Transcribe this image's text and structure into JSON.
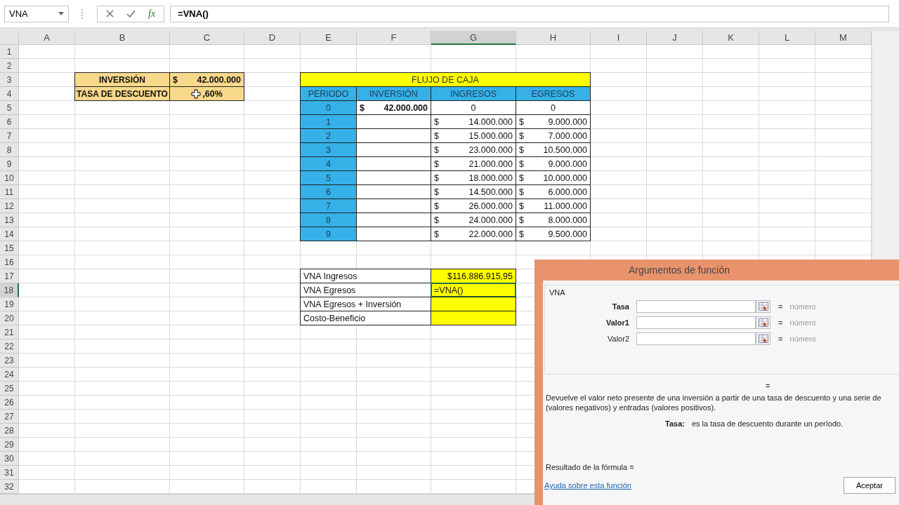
{
  "formula_bar": {
    "name_box": "VNA",
    "function_button": "fx",
    "formula": "=VNA()"
  },
  "sheet": {
    "columns": [
      {
        "label": "A",
        "selected": false
      },
      {
        "label": "B",
        "selected": false
      },
      {
        "label": "C",
        "selected": false
      },
      {
        "label": "D",
        "selected": false
      },
      {
        "label": "E",
        "selected": false
      },
      {
        "label": "F",
        "selected": false
      },
      {
        "label": "G",
        "selected": true
      },
      {
        "label": "H",
        "selected": false
      },
      {
        "label": "I",
        "selected": false
      },
      {
        "label": "J",
        "selected": false
      },
      {
        "label": "K",
        "selected": false
      },
      {
        "label": "L",
        "selected": false
      },
      {
        "label": "M",
        "selected": false
      }
    ],
    "rows": [
      {
        "label": "1",
        "selected": false
      },
      {
        "label": "2",
        "selected": false
      },
      {
        "label": "3",
        "selected": false,
        "cells": [
          {
            "kind": "blank"
          },
          {
            "kind": "tan-label",
            "text": "INVERSIÓN"
          },
          {
            "kind": "tan-currency",
            "symbol": "$",
            "amount": "42.000.000"
          },
          {
            "kind": "blank"
          },
          {
            "kind": "title",
            "text": "FLUJO DE CAJA"
          }
        ]
      },
      {
        "label": "4",
        "selected": false,
        "cells": [
          {
            "kind": "blank"
          },
          {
            "kind": "tan-label",
            "text": "TASA DE DESCUENTO"
          },
          {
            "kind": "tan-percent",
            "text": ",60%"
          },
          {
            "kind": "blank"
          },
          {
            "kind": "blue",
            "text": "PERIODO"
          },
          {
            "kind": "blue",
            "text": "INVERSIÓN"
          },
          {
            "kind": "blue",
            "text": "INGRESOS"
          },
          {
            "kind": "blue",
            "text": "EGRESOS"
          }
        ]
      },
      {
        "label": "5",
        "selected": false,
        "cells": [
          {
            "kind": "blank"
          },
          {
            "kind": "blank"
          },
          {
            "kind": "blank"
          },
          {
            "kind": "blank"
          },
          {
            "kind": "blue",
            "text": "0"
          },
          {
            "kind": "currency-bold",
            "symbol": "$",
            "amount": "42.000.000"
          },
          {
            "kind": "number",
            "text": "0"
          },
          {
            "kind": "number",
            "text": "0"
          }
        ]
      },
      {
        "label": "6",
        "selected": false,
        "cells": [
          {
            "kind": "blank"
          },
          {
            "kind": "blank"
          },
          {
            "kind": "blank"
          },
          {
            "kind": "blank"
          },
          {
            "kind": "blue",
            "text": "1"
          },
          {
            "kind": "empty"
          },
          {
            "kind": "currency",
            "symbol": "$",
            "amount": "14.000.000"
          },
          {
            "kind": "currency",
            "symbol": "$",
            "amount": "9.000.000"
          }
        ]
      },
      {
        "label": "7",
        "selected": false,
        "cells": [
          {
            "kind": "blank"
          },
          {
            "kind": "blank"
          },
          {
            "kind": "blank"
          },
          {
            "kind": "blank"
          },
          {
            "kind": "blue",
            "text": "2"
          },
          {
            "kind": "empty"
          },
          {
            "kind": "currency",
            "symbol": "$",
            "amount": "15.000.000"
          },
          {
            "kind": "currency",
            "symbol": "$",
            "amount": "7.000.000"
          }
        ]
      },
      {
        "label": "8",
        "selected": false,
        "cells": [
          {
            "kind": "blank"
          },
          {
            "kind": "blank"
          },
          {
            "kind": "blank"
          },
          {
            "kind": "blank"
          },
          {
            "kind": "blue",
            "text": "3"
          },
          {
            "kind": "empty"
          },
          {
            "kind": "currency",
            "symbol": "$",
            "amount": "23.000.000"
          },
          {
            "kind": "currency",
            "symbol": "$",
            "amount": "10.500.000"
          }
        ]
      },
      {
        "label": "9",
        "selected": false,
        "cells": [
          {
            "kind": "blank"
          },
          {
            "kind": "blank"
          },
          {
            "kind": "blank"
          },
          {
            "kind": "blank"
          },
          {
            "kind": "blue",
            "text": "4"
          },
          {
            "kind": "empty"
          },
          {
            "kind": "currency",
            "symbol": "$",
            "amount": "21.000.000"
          },
          {
            "kind": "currency",
            "symbol": "$",
            "amount": "9.000.000"
          }
        ]
      },
      {
        "label": "10",
        "selected": false,
        "cells": [
          {
            "kind": "blank"
          },
          {
            "kind": "blank"
          },
          {
            "kind": "blank"
          },
          {
            "kind": "blank"
          },
          {
            "kind": "blue",
            "text": "5"
          },
          {
            "kind": "empty"
          },
          {
            "kind": "currency",
            "symbol": "$",
            "amount": "18.000.000"
          },
          {
            "kind": "currency",
            "symbol": "$",
            "amount": "10.000.000"
          }
        ]
      },
      {
        "label": "11",
        "selected": false,
        "cells": [
          {
            "kind": "blank"
          },
          {
            "kind": "blank"
          },
          {
            "kind": "blank"
          },
          {
            "kind": "blank"
          },
          {
            "kind": "blue",
            "text": "6"
          },
          {
            "kind": "empty"
          },
          {
            "kind": "currency",
            "symbol": "$",
            "amount": "14.500.000"
          },
          {
            "kind": "currency",
            "symbol": "$",
            "amount": "6.000.000"
          }
        ]
      },
      {
        "label": "12",
        "selected": false,
        "cells": [
          {
            "kind": "blank"
          },
          {
            "kind": "blank"
          },
          {
            "kind": "blank"
          },
          {
            "kind": "blank"
          },
          {
            "kind": "blue",
            "text": "7"
          },
          {
            "kind": "empty"
          },
          {
            "kind": "currency",
            "symbol": "$",
            "amount": "26.000.000"
          },
          {
            "kind": "currency",
            "symbol": "$",
            "amount": "11.000.000"
          }
        ]
      },
      {
        "label": "13",
        "selected": false,
        "cells": [
          {
            "kind": "blank"
          },
          {
            "kind": "blank"
          },
          {
            "kind": "blank"
          },
          {
            "kind": "blank"
          },
          {
            "kind": "blue",
            "text": "8"
          },
          {
            "kind": "empty"
          },
          {
            "kind": "currency",
            "symbol": "$",
            "amount": "24.000.000"
          },
          {
            "kind": "currency",
            "symbol": "$",
            "amount": "8.000.000"
          }
        ]
      },
      {
        "label": "14",
        "selected": false,
        "cells": [
          {
            "kind": "blank"
          },
          {
            "kind": "blank"
          },
          {
            "kind": "blank"
          },
          {
            "kind": "blank"
          },
          {
            "kind": "blue",
            "text": "9"
          },
          {
            "kind": "empty"
          },
          {
            "kind": "currency",
            "symbol": "$",
            "amount": "22.000.000"
          },
          {
            "kind": "currency",
            "symbol": "$",
            "amount": "9.500.000"
          }
        ]
      },
      {
        "label": "15",
        "selected": false
      },
      {
        "label": "16",
        "selected": false
      },
      {
        "label": "17",
        "selected": false,
        "cells": [
          {
            "kind": "blank"
          },
          {
            "kind": "blank"
          },
          {
            "kind": "blank"
          },
          {
            "kind": "blank"
          },
          {
            "kind": "label",
            "text": "VNA Ingresos"
          },
          {
            "kind": "yellow-right",
            "text": "$116.886.915,95",
            "active": false
          }
        ]
      },
      {
        "label": "18",
        "selected": true,
        "cells": [
          {
            "kind": "blank"
          },
          {
            "kind": "blank"
          },
          {
            "kind": "blank"
          },
          {
            "kind": "blank"
          },
          {
            "kind": "label",
            "text": "VNA  Egresos"
          },
          {
            "kind": "yellow-left",
            "text": "=VNA()",
            "active": true
          }
        ]
      },
      {
        "label": "19",
        "selected": false,
        "cells": [
          {
            "kind": "blank"
          },
          {
            "kind": "blank"
          },
          {
            "kind": "blank"
          },
          {
            "kind": "blank"
          },
          {
            "kind": "label",
            "text": "VNA Egresos + Inversión"
          },
          {
            "kind": "yellow-left",
            "active": false
          }
        ]
      },
      {
        "label": "20",
        "selected": false,
        "cells": [
          {
            "kind": "blank"
          },
          {
            "kind": "blank"
          },
          {
            "kind": "blank"
          },
          {
            "kind": "blank"
          },
          {
            "kind": "label",
            "text": "Costo-Beneficio"
          },
          {
            "kind": "yellow-left",
            "active": false
          }
        ]
      },
      {
        "label": "21",
        "selected": false
      },
      {
        "label": "22",
        "selected": false
      },
      {
        "label": "23",
        "selected": false
      },
      {
        "label": "24",
        "selected": false
      },
      {
        "label": "25",
        "selected": false
      },
      {
        "label": "26",
        "selected": false
      },
      {
        "label": "27",
        "selected": false
      },
      {
        "label": "28",
        "selected": false
      },
      {
        "label": "29",
        "selected": false
      },
      {
        "label": "30",
        "selected": false
      },
      {
        "label": "31",
        "selected": false
      },
      {
        "label": "32",
        "selected": false
      }
    ]
  },
  "dialog": {
    "title": "Argumentos de función",
    "function_name": "VNA",
    "arguments": [
      {
        "label": "Tasa",
        "required": true,
        "equals": "=",
        "hint": "número"
      },
      {
        "label": "Valor1",
        "required": true,
        "equals": "=",
        "hint": "número"
      },
      {
        "label": "Valor2",
        "required": false,
        "equals": "=",
        "hint": "número"
      }
    ],
    "result_equals": "=",
    "description_lines": [
      "Devuelve el valor neto presente de una inversión a partir de una tasa de descuento y una serie de",
      "(valores negativos) y entradas (valores positivos)."
    ],
    "argument_help": {
      "name": "Tasa:",
      "text": "es la tasa de descuento durante un período."
    },
    "result_label": "Resultado de la fórmula =",
    "help_link": "Ayuda sobre esta función",
    "ok_button": "Aceptar"
  }
}
